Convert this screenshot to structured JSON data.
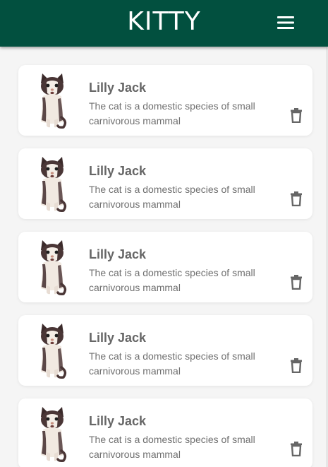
{
  "app": {
    "title": "KITTY",
    "menu_icon": "hamburger-menu-icon",
    "bar_color": "#02503f"
  },
  "cards": [
    {
      "name": "Lilly Jack",
      "description": "The cat is a domestic species of small carnivorous mammal",
      "image": "cat-photo",
      "action_icon": "trash-icon"
    },
    {
      "name": "Lilly Jack",
      "description": "The cat is a domestic species of small carnivorous mammal",
      "image": "cat-photo",
      "action_icon": "trash-icon"
    },
    {
      "name": "Lilly Jack",
      "description": "The cat is a domestic species of small carnivorous mammal",
      "image": "cat-photo",
      "action_icon": "trash-icon"
    },
    {
      "name": "Lilly Jack",
      "description": "The cat is a domestic species of small carnivorous mammal",
      "image": "cat-photo",
      "action_icon": "trash-icon"
    },
    {
      "name": "Lilly Jack",
      "description": "The cat is a domestic species of small carnivorous mammal",
      "image": "cat-photo",
      "action_icon": "trash-icon"
    }
  ]
}
